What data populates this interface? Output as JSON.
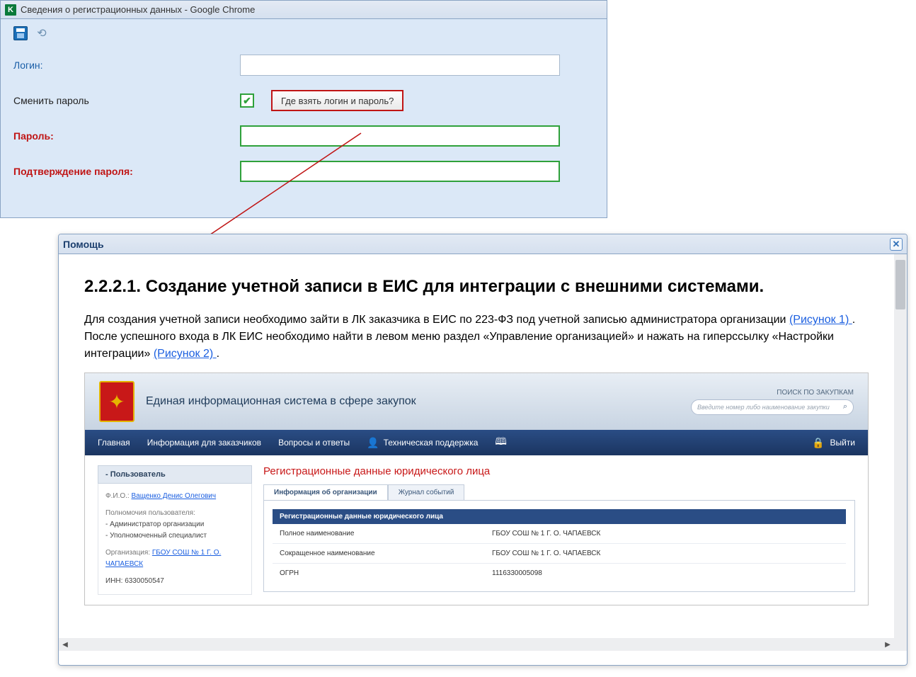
{
  "top": {
    "title": "Сведения о регистрационных данных - Google Chrome",
    "icon_letter": "K",
    "labels": {
      "login": "Логин:",
      "change_pw": "Сменить пароль",
      "help_btn": "Где взять логин и пароль?",
      "password": "Пароль:",
      "confirm": "Подтверждение пароля:"
    },
    "values": {
      "login": "",
      "password": "",
      "confirm": ""
    },
    "checked": true
  },
  "help": {
    "title": "Помощь",
    "close": "✕",
    "heading": "2.2.2.1. Создание учетной записи в ЕИС для интеграции с внешними системами.",
    "p_part1": "Для создания учетной записи необходимо зайти в ЛК заказчика в ЕИС по 223-ФЗ под учетной записью администратора организации ",
    "link1": "(Рисунок 1) ",
    "p_part2": ". После успешного входа в ЛК ЕИС необходимо найти в левом меню раздел «Управление организацией» и нажать на гиперссылку «Настройки интеграции» ",
    "link2": "(Рисунок 2) ",
    "p_part3": "."
  },
  "eis": {
    "header_title": "Единая информационная система в сфере закупок",
    "search_label": "ПОИСК ПО ЗАКУПКАМ",
    "search_placeholder": "Введите номер либо наименование закупки",
    "nav": {
      "main": "Главная",
      "info": "Информация для заказчиков",
      "faq": "Вопросы и ответы",
      "support": "Техническая поддержка",
      "exit": "Выйти"
    },
    "sidebar": {
      "header": "- Пользователь",
      "fio_label": "Ф.И.О.: ",
      "fio_link": "Ващенко Денис Олегович",
      "perm_label": "Полномочия пользователя:",
      "perm1": "- Администратор организации",
      "perm2": "- Уполномоченный специалист",
      "org_label": "Организация: ",
      "org_link": "ГБОУ СОШ № 1 Г. О. ЧАПАЕВСК",
      "inn": "ИНН: 6330050547"
    },
    "content": {
      "title": "Регистрационные данные юридического лица",
      "tab1": "Информация об организации",
      "tab2": "Журнал событий",
      "panel_header": "Регистрационные данные юридического лица",
      "rows": [
        {
          "label": "Полное наименование",
          "value": "ГБОУ СОШ № 1 Г. О. ЧАПАЕВСК"
        },
        {
          "label": "Сокращенное наименование",
          "value": "ГБОУ СОШ № 1 Г. О. ЧАПАЕВСК"
        },
        {
          "label": "ОГРН",
          "value": "1116330005098"
        }
      ]
    }
  }
}
